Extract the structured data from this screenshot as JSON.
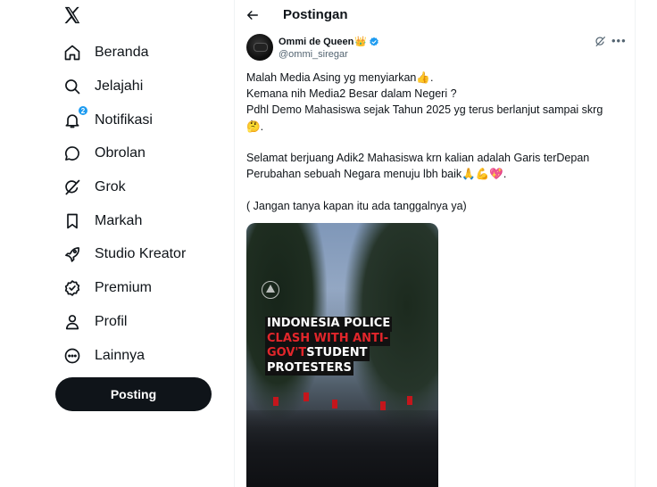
{
  "sidebar": {
    "logo_icon": "x-logo-icon",
    "items": [
      {
        "label": "Beranda",
        "icon": "home-icon"
      },
      {
        "label": "Jelajahi",
        "icon": "search-icon"
      },
      {
        "label": "Notifikasi",
        "icon": "bell-icon",
        "badge": "2"
      },
      {
        "label": "Obrolan",
        "icon": "chat-icon"
      },
      {
        "label": "Grok",
        "icon": "grok-icon"
      },
      {
        "label": "Markah",
        "icon": "bookmark-icon"
      },
      {
        "label": "Studio Kreator",
        "icon": "rocket-icon"
      },
      {
        "label": "Premium",
        "icon": "verified-badge-icon"
      },
      {
        "label": "Profil",
        "icon": "person-icon"
      },
      {
        "label": "Lainnya",
        "icon": "more-circle-icon"
      }
    ],
    "post_button": "Posting"
  },
  "header": {
    "title": "Postingan"
  },
  "tweet": {
    "author_name": "Ommi de Queen",
    "author_emoji": "👑",
    "handle": "@ommi_siregar",
    "lines": [
      "Malah Media Asing yg menyiarkan👍.",
      "Kemana nih Media2 Besar dalam Negeri ?",
      "Pdhl Demo Mahasiswa sejak Tahun 2025 yg terus berlanjut sampai skrg",
      "🤔.",
      "Selamat berjuang Adik2 Mahasiswa krn kalian adalah Garis terDepan",
      "Perubahan sebuah Negara menuju lbh baik🙏💪💖.",
      "( Jangan tanya kapan itu ada tanggalnya ya)"
    ],
    "media_headline": {
      "line1": "INDONESIA POLICE",
      "line2": "CLASH WITH ANTI-",
      "line3a": "GOV'T",
      "line3b": " STUDENT",
      "line4": "PROTESTERS"
    }
  },
  "colors": {
    "accent": "#1d9bf0",
    "text": "#0f1419",
    "secondary": "#536471",
    "post_button_bg": "#0f1419",
    "headline_red": "#e2262b"
  }
}
